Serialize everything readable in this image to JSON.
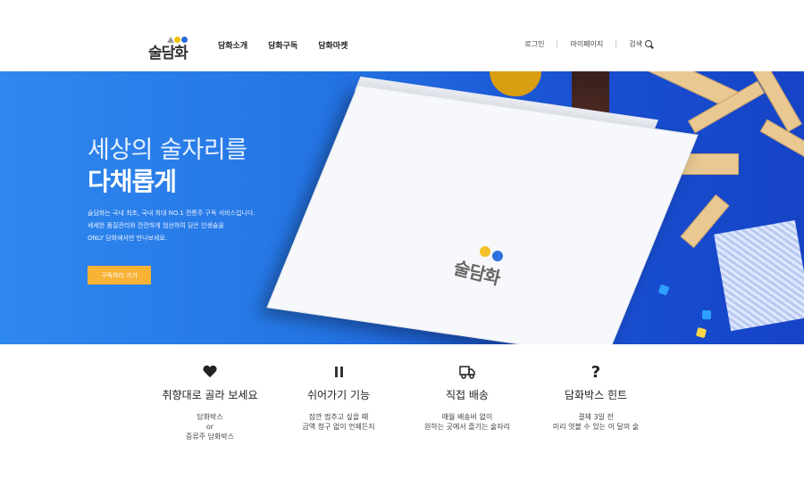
{
  "header": {
    "logo_text": "술담화",
    "nav": [
      "담화소개",
      "담화구독",
      "담화마켓"
    ],
    "util": {
      "login": "로그인",
      "mypage": "마이페이지",
      "search": "검색"
    }
  },
  "hero": {
    "title_line1": "세상의 술자리를",
    "title_line2": "다채롭게",
    "desc": [
      "술담화는 국내 최초, 국내 최대 NO.1 전통주 구독 서비스입니다.",
      "세세한 품질관리와 깐깐하게 엄선하여 담은 인생술을",
      "ONLY 담화에서만 만나보세요."
    ],
    "cta": "구독하러 가기",
    "box_logo": "술담화"
  },
  "features": [
    {
      "icon": "heart-icon",
      "title": "취향대로 골라 보세요",
      "desc": [
        "담화박스",
        "or",
        "증류주 담화박스"
      ]
    },
    {
      "icon": "pause-icon",
      "title": "쉬어가기 기능",
      "desc": [
        "잠깐 멈추고 싶을 때",
        "금액 청구 없이 언제든지"
      ]
    },
    {
      "icon": "truck-icon",
      "title": "직접 배송",
      "desc": [
        "매월 배송비 없이",
        "원하는 곳에서 즐기는 술자리"
      ]
    },
    {
      "icon": "question-icon",
      "title": "담화박스 힌트",
      "desc": [
        "결제 3일 전",
        "미리 엿볼 수 있는 이 달의 술"
      ]
    }
  ],
  "colors": {
    "hero_blue": "#2474e4",
    "cta_orange": "#f8b236"
  }
}
